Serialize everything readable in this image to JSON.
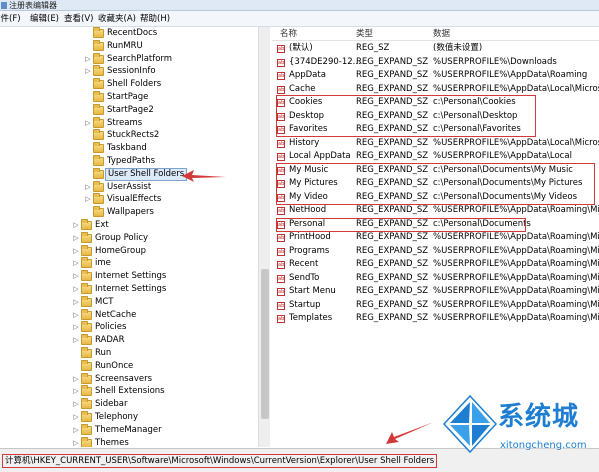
{
  "window": {
    "title": "注册表编辑器"
  },
  "menu": [
    {
      "label": "文件(F)"
    },
    {
      "label": "编辑(E)"
    },
    {
      "label": "查看(V)"
    },
    {
      "label": "收藏夹(A)"
    },
    {
      "label": "帮助(H)"
    }
  ],
  "tree": {
    "items": [
      {
        "label": "RecentDocs",
        "expander": "",
        "selected": false
      },
      {
        "label": "RunMRU",
        "expander": "",
        "selected": false
      },
      {
        "label": "SearchPlatform",
        "expander": "▷",
        "selected": false
      },
      {
        "label": "SessionInfo",
        "expander": "▷",
        "selected": false
      },
      {
        "label": "Shell Folders",
        "expander": "",
        "selected": false
      },
      {
        "label": "StartPage",
        "expander": "",
        "selected": false
      },
      {
        "label": "StartPage2",
        "expander": "",
        "selected": false
      },
      {
        "label": "Streams",
        "expander": "▷",
        "selected": false
      },
      {
        "label": "StuckRects2",
        "expander": "",
        "selected": false
      },
      {
        "label": "Taskband",
        "expander": "",
        "selected": false
      },
      {
        "label": "TypedPaths",
        "expander": "",
        "selected": false
      },
      {
        "label": "User Shell Folders",
        "expander": "",
        "selected": true
      },
      {
        "label": "UserAssist",
        "expander": "▷",
        "selected": false
      },
      {
        "label": "VisualEffects",
        "expander": "▷",
        "selected": false
      },
      {
        "label": "Wallpapers",
        "expander": "",
        "selected": false
      },
      {
        "label": "Ext",
        "expander": "▷",
        "selected": false
      },
      {
        "label": "Group Policy",
        "expander": "▷",
        "selected": false
      },
      {
        "label": "HomeGroup",
        "expander": "▷",
        "selected": false
      },
      {
        "label": "ime",
        "expander": "▷",
        "selected": false
      },
      {
        "label": "Internet Settings",
        "expander": "▷",
        "selected": false
      },
      {
        "label": "Internet Settings",
        "expander": "▷",
        "selected": false
      },
      {
        "label": "MCT",
        "expander": "▷",
        "selected": false
      },
      {
        "label": "NetCache",
        "expander": "▷",
        "selected": false
      },
      {
        "label": "Policies",
        "expander": "▷",
        "selected": false
      },
      {
        "label": "RADAR",
        "expander": "▷",
        "selected": false
      },
      {
        "label": "Run",
        "expander": "",
        "selected": false
      },
      {
        "label": "RunOnce",
        "expander": "",
        "selected": false
      },
      {
        "label": "Screensavers",
        "expander": "▷",
        "selected": false
      },
      {
        "label": "Shell Extensions",
        "expander": "▷",
        "selected": false
      },
      {
        "label": "Sidebar",
        "expander": "▷",
        "selected": false
      },
      {
        "label": "Telephony",
        "expander": "▷",
        "selected": false
      },
      {
        "label": "ThemeManager",
        "expander": "▷",
        "selected": false
      },
      {
        "label": "Themes",
        "expander": "▷",
        "selected": false
      }
    ]
  },
  "list": {
    "headers": {
      "name": "名称",
      "type": "类型",
      "data": "数据"
    },
    "rows": [
      {
        "name": "(默认)",
        "type": "REG_SZ",
        "data": "(数值未设置)"
      },
      {
        "name": "{374DE290-12...",
        "type": "REG_EXPAND_SZ",
        "data": "%USERPROFILE%\\Downloads"
      },
      {
        "name": "AppData",
        "type": "REG_EXPAND_SZ",
        "data": "%USERPROFILE%\\AppData\\Roaming"
      },
      {
        "name": "Cache",
        "type": "REG_EXPAND_SZ",
        "data": "%USERPROFILE%\\AppData\\Local\\Microsoft\\"
      },
      {
        "name": "Cookies",
        "type": "REG_EXPAND_SZ",
        "data": "c:\\Personal\\Cookies"
      },
      {
        "name": "Desktop",
        "type": "REG_EXPAND_SZ",
        "data": "c:\\Personal\\Desktop"
      },
      {
        "name": "Favorites",
        "type": "REG_EXPAND_SZ",
        "data": "c:\\Personal\\Favorites"
      },
      {
        "name": "History",
        "type": "REG_EXPAND_SZ",
        "data": "%USERPROFILE%\\AppData\\Local\\Microsoft\\"
      },
      {
        "name": "Local AppData",
        "type": "REG_EXPAND_SZ",
        "data": "%USERPROFILE%\\AppData\\Local"
      },
      {
        "name": "My Music",
        "type": "REG_EXPAND_SZ",
        "data": "c:\\Personal\\Documents\\My Music"
      },
      {
        "name": "My Pictures",
        "type": "REG_EXPAND_SZ",
        "data": "c:\\Personal\\Documents\\My Pictures"
      },
      {
        "name": "My Video",
        "type": "REG_EXPAND_SZ",
        "data": "c:\\Personal\\Documents\\My Videos"
      },
      {
        "name": "NetHood",
        "type": "REG_EXPAND_SZ",
        "data": "%USERPROFILE%\\AppData\\Roaming\\Micros"
      },
      {
        "name": "Personal",
        "type": "REG_EXPAND_SZ",
        "data": "c:\\Personal\\Documents"
      },
      {
        "name": "PrintHood",
        "type": "REG_EXPAND_SZ",
        "data": "%USERPROFILE%\\AppData\\Roaming\\Micros"
      },
      {
        "name": "Programs",
        "type": "REG_EXPAND_SZ",
        "data": "%USERPROFILE%\\AppData\\Roaming\\Micros"
      },
      {
        "name": "Recent",
        "type": "REG_EXPAND_SZ",
        "data": "%USERPROFILE%\\AppData\\Roaming\\Micros"
      },
      {
        "name": "SendTo",
        "type": "REG_EXPAND_SZ",
        "data": "%USERPROFILE%\\AppData\\Roaming\\Micros"
      },
      {
        "name": "Start Menu",
        "type": "REG_EXPAND_SZ",
        "data": "%USERPROFILE%\\AppData\\Roaming\\Micros"
      },
      {
        "name": "Startup",
        "type": "REG_EXPAND_SZ",
        "data": "%USERPROFILE%\\AppData\\Roaming\\Micros"
      },
      {
        "name": "Templates",
        "type": "REG_EXPAND_SZ",
        "data": "%USERPROFILE%\\AppData\\Roaming\\Micros"
      }
    ]
  },
  "status": {
    "path": "计算机\\HKEY_CURRENT_USER\\Software\\Microsoft\\Windows\\CurrentVersion\\Explorer\\User Shell Folders"
  },
  "watermark": {
    "brand": "系统城",
    "domain": "xitongcheng.com"
  },
  "colors": {
    "highlight": "#d23a3a",
    "watermark": "#1e7ed2",
    "selection": "#dce9f8"
  }
}
